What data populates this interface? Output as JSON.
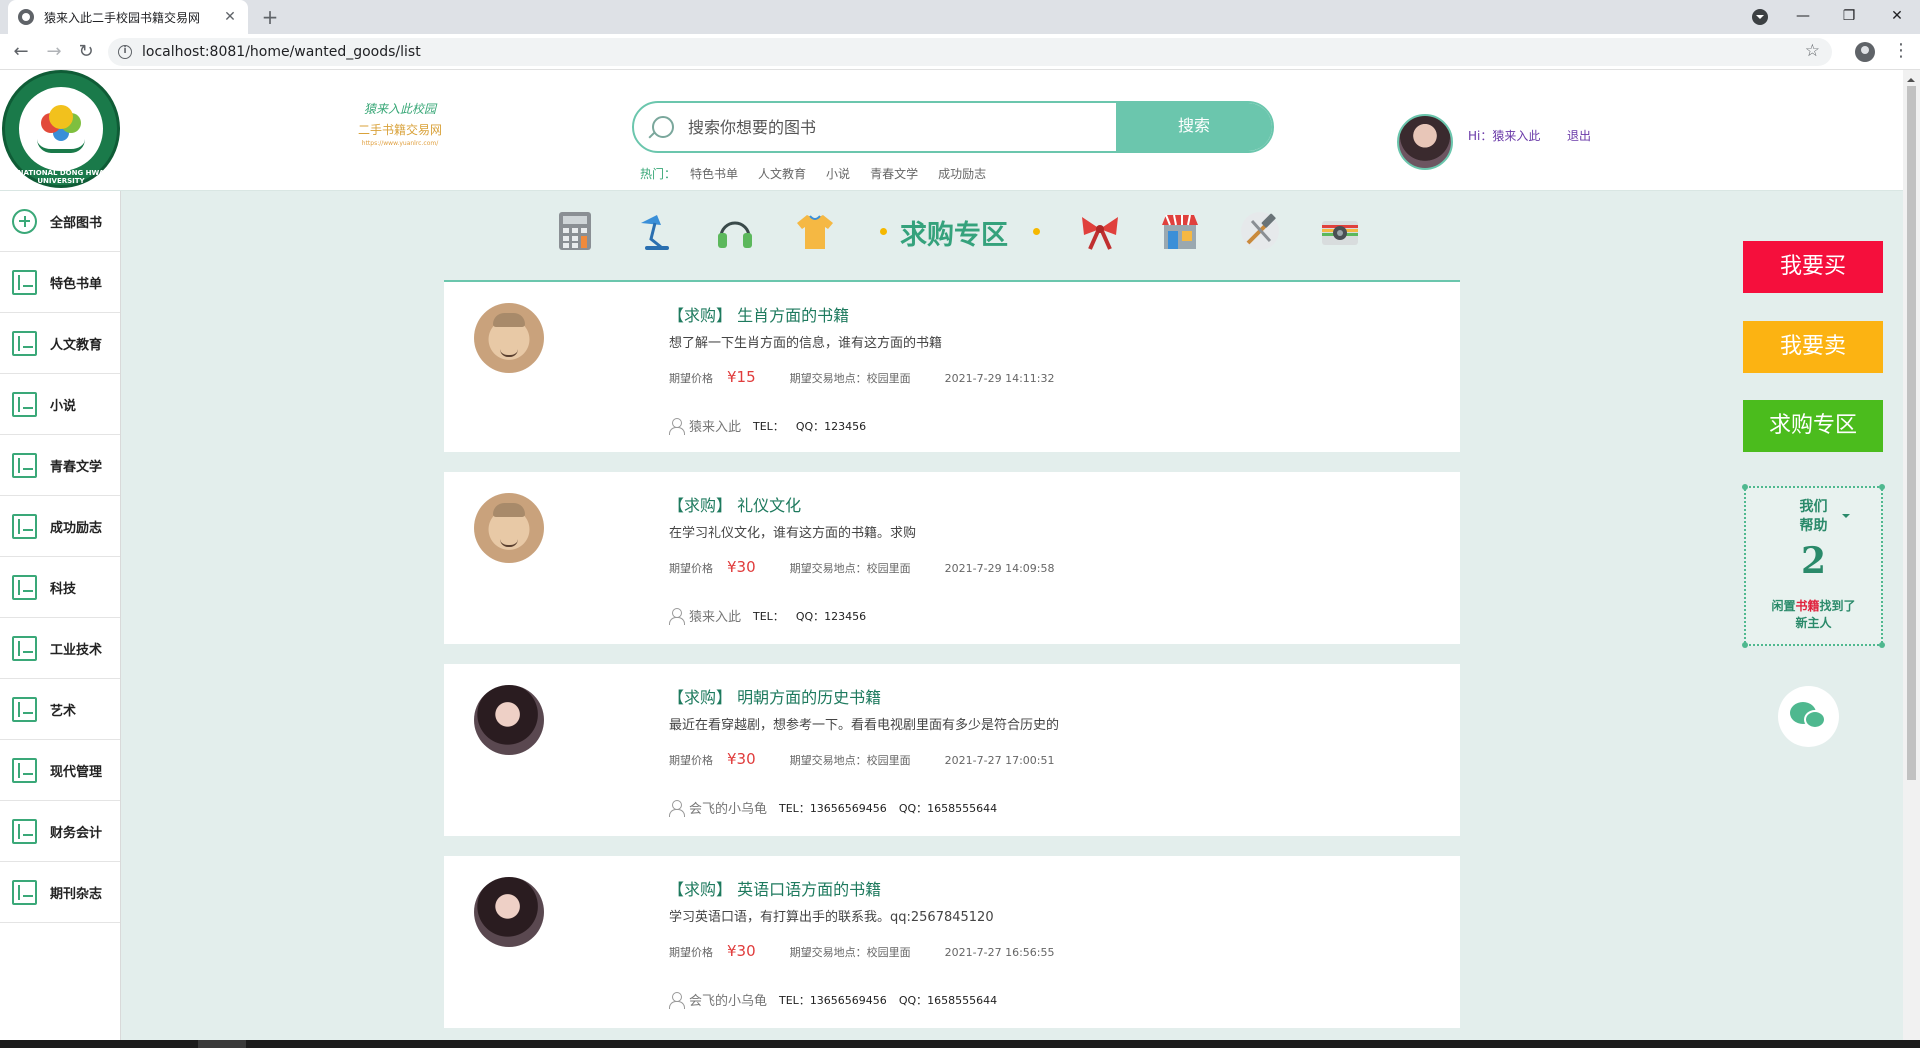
{
  "browser": {
    "tab_title": "猿来入此二手校园书籍交易网",
    "tab_close": "✕",
    "new_tab": "+",
    "url": "localhost:8081/home/wanted_goods/list",
    "info": "i",
    "star": "☆",
    "menu": "⋮",
    "back": "←",
    "forward": "→",
    "reload": "↻",
    "minimize": "—",
    "restore": "❐",
    "close": "✕"
  },
  "header": {
    "univ_logo_text": "NATIONAL DONG HWA UNIVERSITY",
    "site_logo": {
      "line1": "猿来入此校园",
      "line2": "二手书籍交易网",
      "line3": "https://www.yuanlrc.com/"
    },
    "search": {
      "placeholder": "搜索你想要的图书",
      "button": "搜索"
    },
    "hot_label": "热门：",
    "hot_items": [
      "特色书单",
      "人文教育",
      "小说",
      "青春文学",
      "成功励志"
    ],
    "user_greeting": "Hi：猿来入此",
    "logout": "退出"
  },
  "sidebar": {
    "items": [
      {
        "label": "全部图书",
        "icon": "plus-circle-icon"
      },
      {
        "label": "特色书单",
        "icon": "book-icon"
      },
      {
        "label": "人文教育",
        "icon": "book-icon"
      },
      {
        "label": "小说",
        "icon": "book-icon"
      },
      {
        "label": "青春文学",
        "icon": "book-icon"
      },
      {
        "label": "成功励志",
        "icon": "book-icon"
      },
      {
        "label": "科技",
        "icon": "book-icon"
      },
      {
        "label": "工业技术",
        "icon": "book-icon"
      },
      {
        "label": "艺术",
        "icon": "book-icon"
      },
      {
        "label": "现代管理",
        "icon": "book-icon"
      },
      {
        "label": "财务会计",
        "icon": "book-icon"
      },
      {
        "label": "期刊杂志",
        "icon": "book-icon"
      }
    ]
  },
  "category_bar": {
    "title": "求购专区",
    "icons": [
      "calculator-icon",
      "desk-lamp-icon",
      "headphones-icon",
      "tshirt-icon",
      "bow-icon",
      "shop-icon",
      "tools-icon",
      "camera-icon"
    ]
  },
  "listings": [
    {
      "title": "【求购】 生肖方面的书籍",
      "desc": "想了解一下生肖方面的信息，谁有这方面的书籍",
      "price_label": "期望价格",
      "price": "¥15",
      "location": "期望交易地点：校园里面",
      "time": "2021-7-29 14:11:32",
      "user": "猿来入此",
      "tel": "TEL：",
      "qq": "QQ：123456",
      "avatar": "man"
    },
    {
      "title": "【求购】 礼仪文化",
      "desc": "在学习礼仪文化，谁有这方面的书籍。求购",
      "price_label": "期望价格",
      "price": "¥30",
      "location": "期望交易地点：校园里面",
      "time": "2021-7-29 14:09:58",
      "user": "猿来入此",
      "tel": "TEL：",
      "qq": "QQ：123456",
      "avatar": "man"
    },
    {
      "title": "【求购】 明朝方面的历史书籍",
      "desc": "最近在看穿越剧，想参考一下。看看电视剧里面有多少是符合历史的",
      "price_label": "期望价格",
      "price": "¥30",
      "location": "期望交易地点：校园里面",
      "time": "2021-7-27 17:00:51",
      "user": "会飞的小乌龟",
      "tel": "TEL：13656569456",
      "qq": "QQ：1658555644",
      "avatar": "woman"
    },
    {
      "title": "【求购】 英语口语方面的书籍",
      "desc": "学习英语口语，有打算出手的联系我。qq:2567845120",
      "price_label": "期望价格",
      "price": "¥30",
      "location": "期望交易地点：校园里面",
      "time": "2021-7-27 16:56:55",
      "user": "会飞的小乌龟",
      "tel": "TEL：13656569456",
      "qq": "QQ：1658555644",
      "avatar": "woman"
    }
  ],
  "float_panel": {
    "buy": "我要买",
    "sell": "我要卖",
    "want": "求购专区",
    "help_title_1": "我们",
    "help_title_2": "帮助",
    "help_count": "2",
    "help_text_a": "闲置",
    "help_text_b": "书籍",
    "help_text_c": "找到了",
    "help_text_d": "新主人",
    "colors": {
      "buy": "#f50f3c",
      "sell": "#fcb312",
      "want": "#4bbc1d",
      "accent": "#6bc6ad"
    }
  }
}
